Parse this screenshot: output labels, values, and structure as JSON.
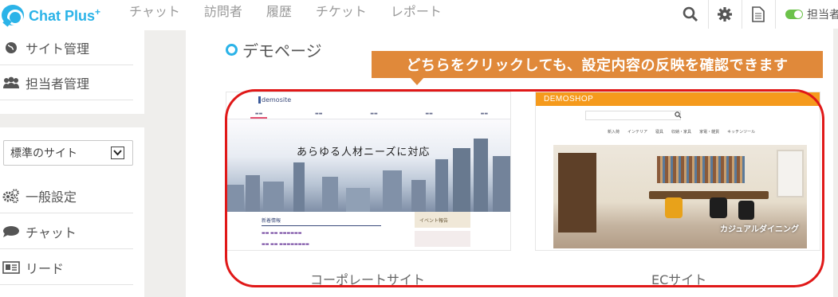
{
  "app": {
    "name": "Chat Plus",
    "brand_color": "#2bb3e8"
  },
  "nav": {
    "items": [
      "チャット",
      "訪問者",
      "履歴",
      "チケット",
      "レポート"
    ]
  },
  "header": {
    "agent_label": "担当者",
    "agent_status_color": "#6cc24a"
  },
  "sidebar": {
    "group1": [
      {
        "label": "サイト管理",
        "icon": "globe-icon"
      },
      {
        "label": "担当者管理",
        "icon": "users-icon"
      }
    ],
    "site_select": {
      "value": "標準のサイト"
    },
    "group2": [
      {
        "label": "一般設定",
        "icon": "gears-icon"
      },
      {
        "label": "チャット",
        "icon": "speech-bubble-icon"
      },
      {
        "label": "リード",
        "icon": "id-card-icon"
      }
    ]
  },
  "main": {
    "section_title": "デモページ",
    "callout": "どちらをクリックしても、設定内容の反映を確認できます",
    "callout_color": "#e0893a",
    "frame_color": "#e01818",
    "demos": [
      {
        "label": "コーポレートサイト",
        "logo": "demosite",
        "hero_text": "あらゆる人材ニーズに対応",
        "news_title": "新着情報",
        "banner_event": "イベント報告"
      },
      {
        "label": "ECサイト",
        "logo": "DEMOSHOP",
        "caption": "カジュアルダイニング",
        "categories": [
          "新入荷",
          "インテリア",
          "寝具",
          "収納・家具",
          "家電・雑貨",
          "キッチンツール"
        ]
      }
    ]
  }
}
